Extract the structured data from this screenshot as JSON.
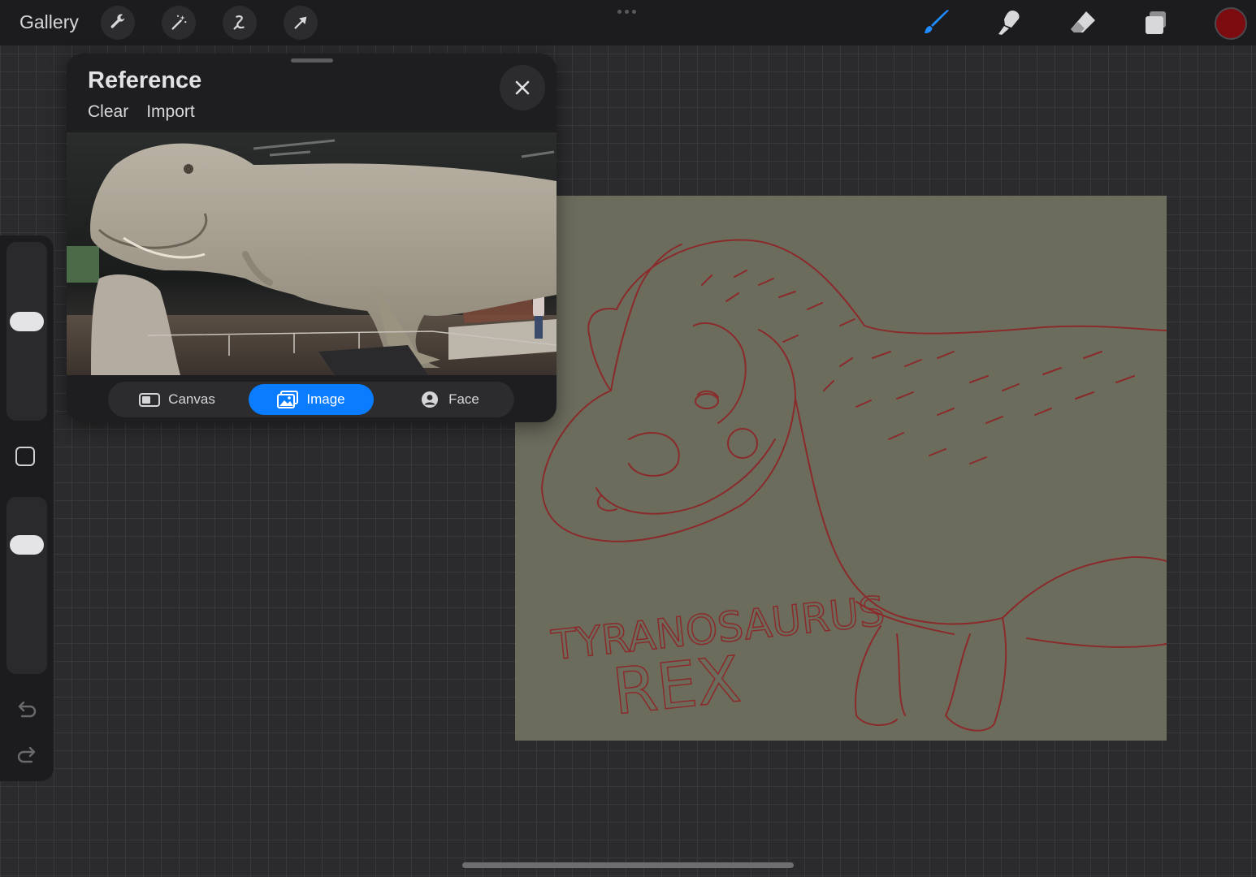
{
  "topbar": {
    "gallery_label": "Gallery",
    "left_tools": [
      "wrench-icon",
      "magic-wand-icon",
      "selection-icon",
      "transform-arrow-icon"
    ],
    "right_tools": [
      "brush-icon",
      "smudge-icon",
      "eraser-icon",
      "layers-icon"
    ],
    "active_tool": "brush-icon",
    "active_color": "#7d0c10",
    "accent_color": "#0a7cff"
  },
  "sidebar": {
    "brush_size_level": 0.56,
    "opacity_level": 0.76,
    "buttons": [
      "modify-square-icon",
      "undo-icon",
      "redo-icon"
    ]
  },
  "reference": {
    "title": "Reference",
    "clear_label": "Clear",
    "import_label": "Import",
    "tabs": [
      {
        "label": "Canvas",
        "icon": "canvas-icon",
        "active": false
      },
      {
        "label": "Image",
        "icon": "image-icon",
        "active": true
      },
      {
        "label": "Face",
        "icon": "face-icon",
        "active": false
      }
    ]
  },
  "canvas": {
    "background_color": "#6c6c5d",
    "sketch_color": "#8a2a2a",
    "sketch_text_line1": "TYRANOSAURUS",
    "sketch_text_line2": "REX"
  }
}
